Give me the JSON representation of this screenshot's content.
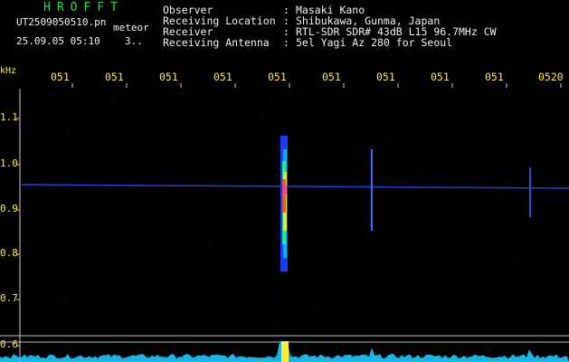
{
  "station": {
    "title": "HROFFT",
    "file_name": "UT2509050510.pn",
    "mode": "meteor",
    "datetime": "25.09.05 05:10",
    "counter": "3.."
  },
  "info": [
    {
      "label": "Observer",
      "sep": ":",
      "value": "Masaki Kano"
    },
    {
      "label": "Receiving Location",
      "sep": ":",
      "value": "Shibukawa, Gunma, Japan"
    },
    {
      "label": "Receiver",
      "sep": ":",
      "value": "RTL-SDR SDR# 43dB L15 96.7MHz CW"
    },
    {
      "label": "Receiving Antenna",
      "sep": ":",
      "value": "5el Yagi Az 280 for Seoul"
    }
  ],
  "y_axis": {
    "unit": "kHz",
    "ticks": [
      "1.1",
      "1.0",
      "0.9",
      "0.8",
      "0.7",
      "0.6"
    ]
  },
  "x_axis": {
    "ticks": [
      "051",
      "051",
      "051",
      "051",
      "051",
      "051",
      "051",
      "051",
      "051",
      "0520"
    ]
  },
  "colors": {
    "background": "#000000",
    "title": "#22e04a",
    "info_text": "#f2f2f2",
    "axis_labels": "#ffee33",
    "signal_line": "#2a4cff",
    "level_trace": "#1ec8ff"
  }
}
